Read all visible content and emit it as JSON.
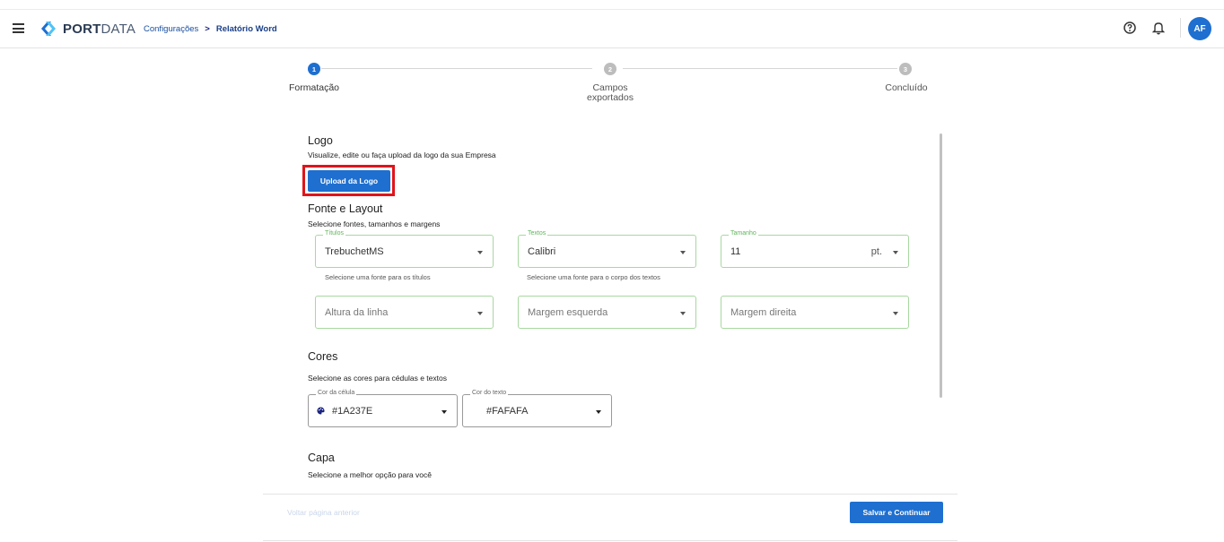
{
  "header": {
    "brand_bold": "PORT",
    "brand_thin": "DATA",
    "breadcrumb": [
      "Configurações",
      "Relatório Word"
    ],
    "breadcrumb_sep": ">",
    "avatar_initials": "AF",
    "icons": [
      "menu-icon",
      "help-icon",
      "bell-icon"
    ]
  },
  "stepper": {
    "steps": [
      {
        "number": "1",
        "label": "Formatação",
        "state": "active"
      },
      {
        "number": "2",
        "label": "Campos exportados",
        "state": "inactive"
      },
      {
        "number": "3",
        "label": "Concluído",
        "state": "inactive"
      }
    ],
    "active_color": "#1E6FD0",
    "inactive_color": "#BDBDBD"
  },
  "logo_section": {
    "title": "Logo",
    "subtitle": "Visualize, edite ou faça upload da logo da sua Empresa",
    "upload_label": "Upload da Logo"
  },
  "font_section": {
    "title": "Fonte e Layout",
    "subtitle": "Selecione fontes, tamanhos e margens",
    "titles_field": {
      "legend": "Títulos",
      "value": "TrebuchetMS",
      "helper": "Selecione uma fonte para os títulos"
    },
    "texts_field": {
      "legend": "Textos",
      "value": "Calibri",
      "helper": "Selecione uma fonte para o corpo dos textos"
    },
    "size_field": {
      "legend": "Tamanho",
      "value": "11",
      "unit": "pt."
    },
    "line_height_placeholder": "Altura da linha",
    "margin_left_placeholder": "Margem esquerda",
    "margin_right_placeholder": "Margem direita"
  },
  "colors_section": {
    "title": "Cores",
    "subtitle": "Selecione as cores para cédulas e textos",
    "cell_color": {
      "legend": "Cor da célula",
      "value": "#1A237E"
    },
    "text_color": {
      "legend": "Cor do texto",
      "value": "#FAFAFA"
    }
  },
  "cover_section": {
    "title": "Capa",
    "subtitle": "Selecione a melhor opção para você"
  },
  "footer": {
    "back_label": "Voltar página anterior",
    "save_label": "Salvar e Continuar"
  }
}
